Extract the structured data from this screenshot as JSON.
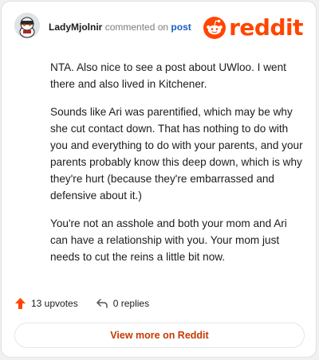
{
  "comment": {
    "username": "LadyMjolnir",
    "action_text": "commented on",
    "post_link": "post",
    "paragraphs": [
      "NTA. Also nice to see a post about UWloo. I went there and also lived in Kitchener.",
      "Sounds like Ari was parentified, which may be why she cut contact down. That has nothing to do with you and everything to do with your parents, and your parents probably know this deep down, which is why they're hurt (because they're embarrassed and defensive about it.)",
      "You're not an asshole and both your mom and Ari can have a relationship with you. Your mom just needs to cut the reins a little bit now."
    ],
    "upvotes_label": "13 upvotes",
    "replies_label": "0 replies",
    "view_more_label": "View more on Reddit"
  },
  "brand": {
    "wordmark": "reddit",
    "color": "#ff4500"
  },
  "icons": {
    "avatar": "snoo-avatar",
    "logo": "reddit-snoo-icon",
    "upvote": "upvote-arrow-icon",
    "reply": "reply-arrow-icon"
  }
}
